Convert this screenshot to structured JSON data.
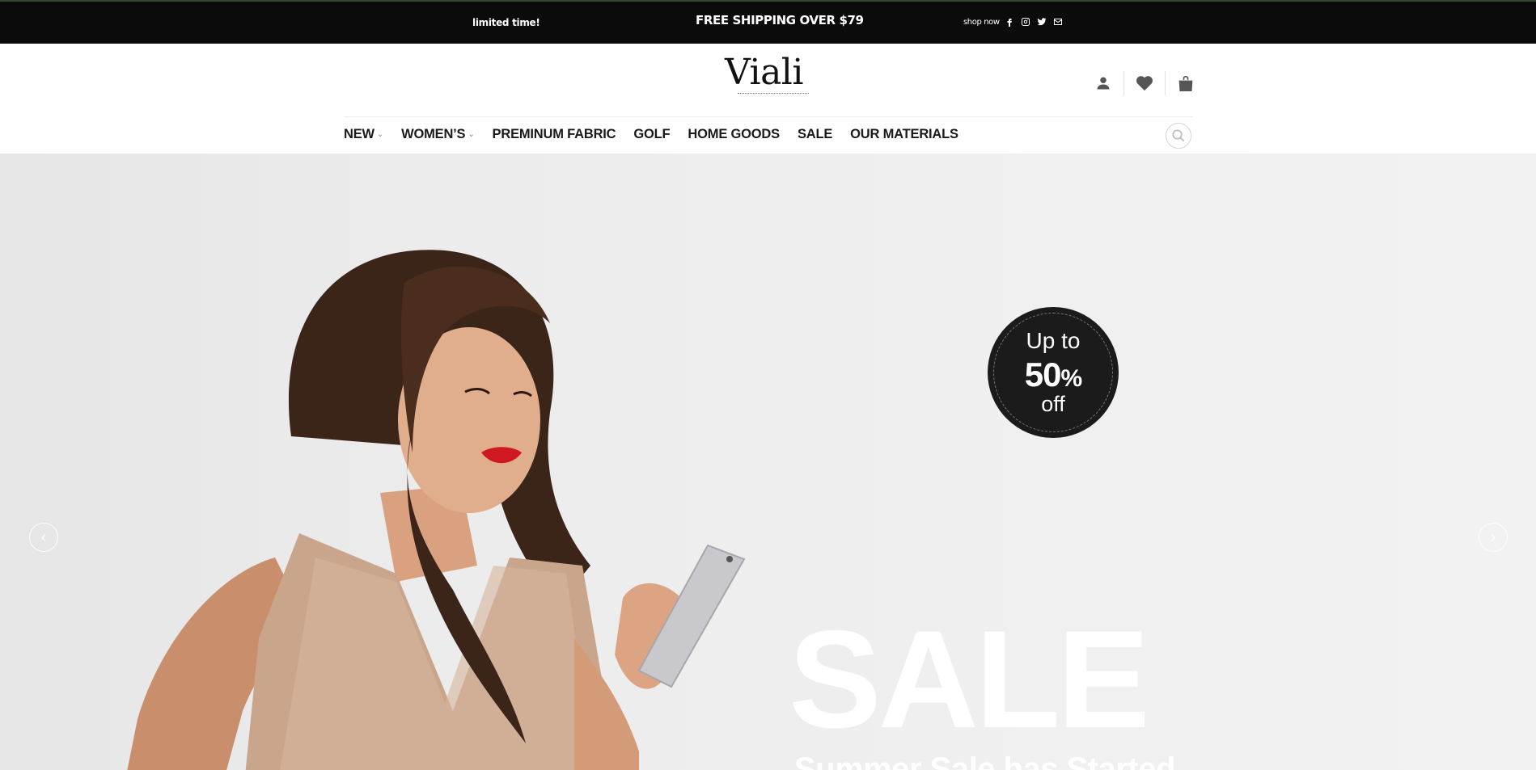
{
  "topbar": {
    "promo_left": "limited time!",
    "promo_center": "FREE SHIPPING OVER $79",
    "shop_now": "shop now",
    "social_icons": [
      "facebook-icon",
      "instagram-icon",
      "twitter-icon",
      "email-icon"
    ]
  },
  "header": {
    "logo": "Viali",
    "icons": [
      "user-icon",
      "heart-icon",
      "shopping-bag-icon"
    ]
  },
  "nav": {
    "items": [
      {
        "label": "NEW",
        "dropdown": true
      },
      {
        "label": "WOMEN’S",
        "dropdown": true
      },
      {
        "label": "PREMINUM FABRIC",
        "dropdown": false
      },
      {
        "label": "GOLF",
        "dropdown": false
      },
      {
        "label": "HOME GOODS",
        "dropdown": false
      },
      {
        "label": "SALE",
        "dropdown": false
      },
      {
        "label": "OUR MATERIALS",
        "dropdown": false
      }
    ],
    "search_icon": "search-icon"
  },
  "hero": {
    "badge": {
      "line1": "Up to",
      "line2_number": "50",
      "line2_unit": "%",
      "line3": "off"
    },
    "headline": "SALE",
    "subheadline": "Summer Sale has Started"
  },
  "colors": {
    "topbar_bg": "#0b0b0b",
    "badge_bg": "#1b1b1b",
    "hero_bg": "#ececec",
    "lip_red": "#d01820"
  }
}
